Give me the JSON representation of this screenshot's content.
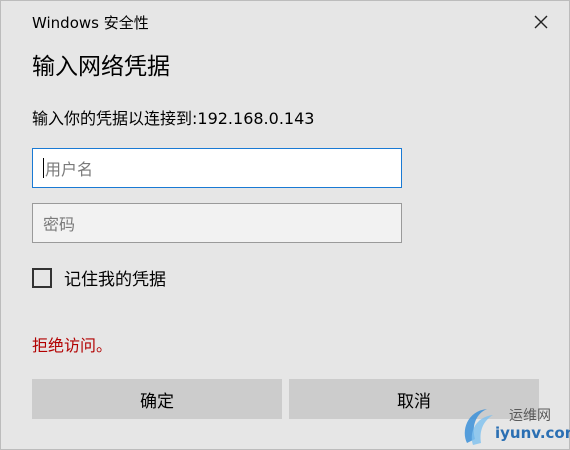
{
  "window": {
    "title": "Windows 安全性",
    "close_icon": "close-icon"
  },
  "dialog": {
    "heading": "输入网络凭据",
    "subtext": "输入你的凭据以连接到:192.168.0.143"
  },
  "form": {
    "username_placeholder": "用户名",
    "password_placeholder": "密码",
    "remember_label": "记住我的凭据",
    "remember_checked": false
  },
  "error": {
    "message": "拒绝访问。",
    "color": "#b20000"
  },
  "buttons": {
    "ok_label": "确定",
    "cancel_label": "取消"
  },
  "watermark": {
    "cn": "运维网",
    "en": "iyunv.com"
  },
  "colors": {
    "focus_border": "#1a7ad4",
    "button_bg": "#cccccc",
    "dialog_bg": "#e6e6e6"
  }
}
